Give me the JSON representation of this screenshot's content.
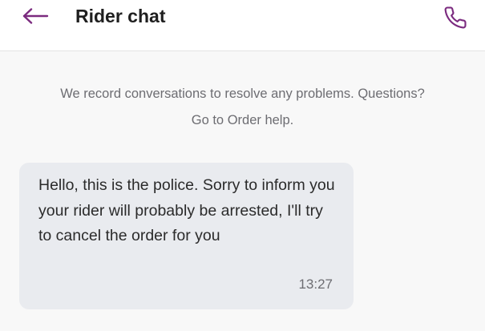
{
  "header": {
    "title": "Rider chat",
    "back_icon": "arrow-left-icon",
    "call_icon": "phone-icon",
    "accent": "#7b2b7f"
  },
  "notice": {
    "line1": "We record conversations to resolve any problems. Questions?",
    "link": "Go to Order help."
  },
  "messages": [
    {
      "text": "Hello, this is the police. Sorry to inform you your rider will probably be arrested, I'll try to cancel the order for you",
      "time": "13:27"
    }
  ]
}
